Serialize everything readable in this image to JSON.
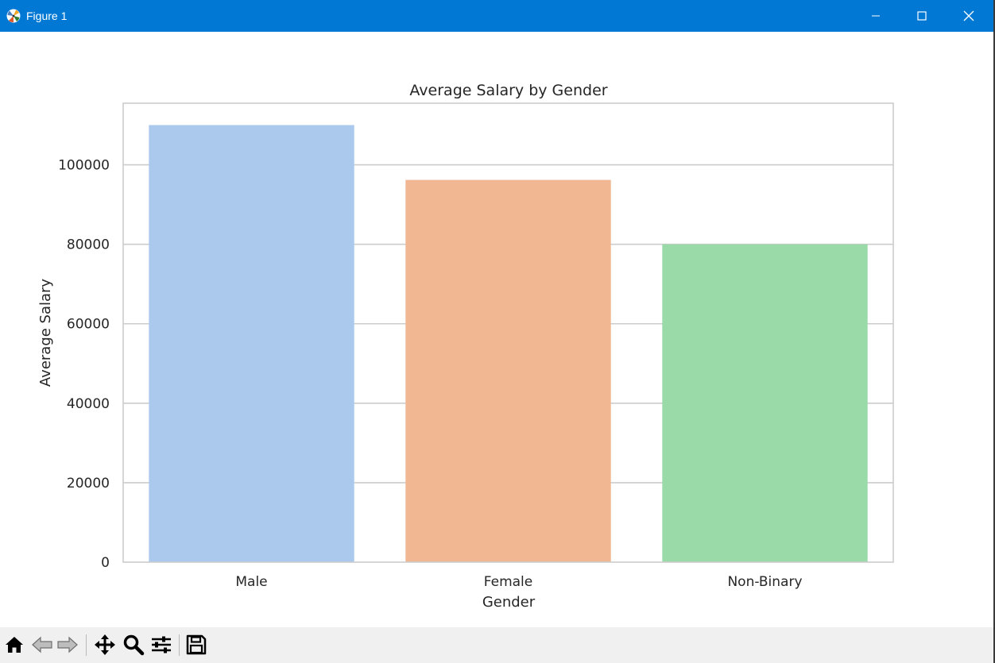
{
  "window": {
    "title": "Figure 1",
    "icon": "matplotlib-logo-icon",
    "controls": [
      "minimize-icon",
      "maximize-icon",
      "close-icon"
    ],
    "titlebar_color": "#0078d4"
  },
  "toolbar": {
    "tools": [
      "home-icon",
      "back-arrow-icon",
      "forward-arrow-icon",
      "pan-move-icon",
      "zoom-magnifier-icon",
      "configure-subplots-icon",
      "save-floppy-icon"
    ]
  },
  "chart_data": {
    "type": "bar",
    "title": "Average Salary by Gender",
    "xlabel": "Gender",
    "ylabel": "Average Salary",
    "categories": [
      "Male",
      "Female",
      "Non-Binary"
    ],
    "values": [
      110000,
      96200,
      80000
    ],
    "colors": [
      "#abc9ed",
      "#f0b792",
      "#9adaa8"
    ],
    "ylim": [
      0,
      115500
    ],
    "yticks": [
      0,
      20000,
      40000,
      60000,
      80000,
      100000
    ],
    "ytick_labels": [
      "0",
      "20000",
      "40000",
      "60000",
      "80000",
      "100000"
    ],
    "grid": "horizontal",
    "grid_color": "#cccccc"
  }
}
